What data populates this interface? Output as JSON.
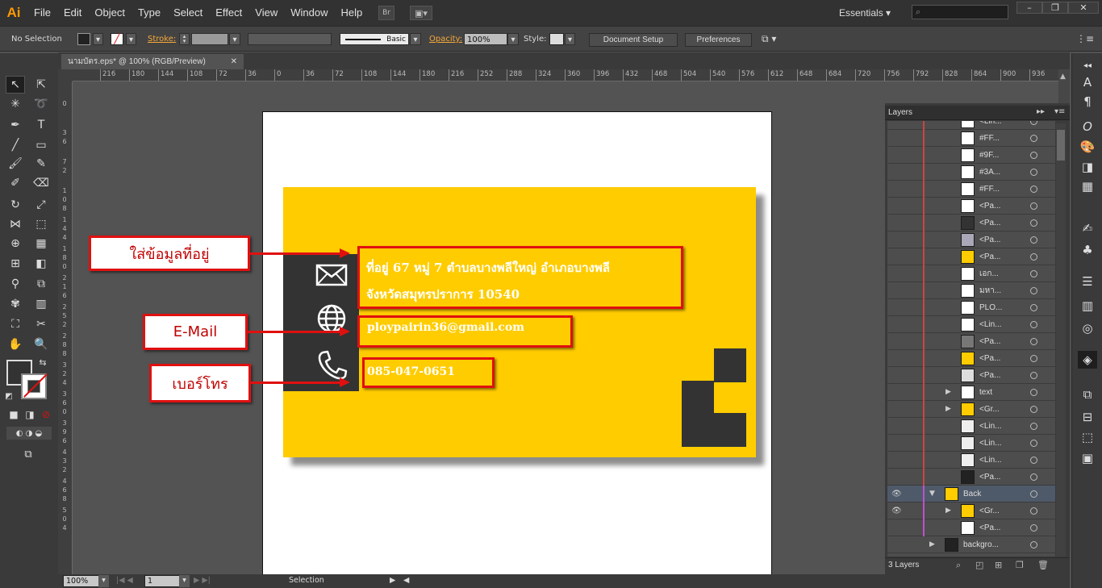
{
  "app": {
    "logo": "Ai"
  },
  "menu": [
    "File",
    "Edit",
    "Object",
    "Type",
    "Select",
    "Effect",
    "View",
    "Window",
    "Help"
  ],
  "bridge_label": "Br",
  "workspace": "Essentials",
  "control": {
    "selection": "No Selection",
    "stroke_label": "Stroke:",
    "stroke_style": "Basic",
    "opacity_label": "Opacity:",
    "opacity_value": "100%",
    "style_label": "Style:",
    "doc_setup": "Document Setup",
    "preferences": "Preferences"
  },
  "document": {
    "tab": "นามบัตร.eps* @ 100% (RGB/Preview)"
  },
  "ruler_h": [
    "216",
    "180",
    "144",
    "108",
    "72",
    "36",
    "0",
    "36",
    "72",
    "108",
    "144",
    "180",
    "216",
    "252",
    "288",
    "324",
    "360",
    "396",
    "432",
    "468",
    "504",
    "540",
    "576",
    "612",
    "648",
    "684",
    "720",
    "756",
    "792",
    "828",
    "864",
    "900",
    "936",
    "97"
  ],
  "ruler_v": [
    "0",
    "3 6",
    "7 2",
    "1 0 8",
    "1 4 4",
    "1 8 0",
    "2 1 6",
    "2 5 2",
    "2 8 8",
    "3 2 4",
    "3 6 0",
    "3 9 6",
    "4 3 2",
    "4 6 8",
    "5 0 4"
  ],
  "card": {
    "address_line1": "ที่อยู่ 67 หมู่ 7 ตำบลบางพลีใหญ่ อำเภอบางพลี",
    "address_line2": "จังหวัดสมุทรปราการ 10540",
    "email": "ploypairin36@gmail.com",
    "phone": "085-047-0651",
    "yellow": "#ffcc00",
    "dark": "#333333"
  },
  "callouts": {
    "address": "ใส่ข้อมูลที่อยู่",
    "email": "E-Mail",
    "phone": "เบอร์โทร",
    "red": "#e01010"
  },
  "layers_panel": {
    "title": "Layers",
    "rows": [
      {
        "name": "<Lin...",
        "thumb": "#ffffff"
      },
      {
        "name": "#FF...",
        "thumb": "#ffffff"
      },
      {
        "name": "#9F...",
        "thumb": "#ffffff"
      },
      {
        "name": "#3A...",
        "thumb": "#ffffff"
      },
      {
        "name": "#FF...",
        "thumb": "#ffffff"
      },
      {
        "name": "<Pa...",
        "thumb": "#ffffff"
      },
      {
        "name": "<Pa...",
        "thumb": "#333333"
      },
      {
        "name": "<Pa...",
        "thumb": "#a8a8b8"
      },
      {
        "name": "<Pa...",
        "thumb": "#ffcc00"
      },
      {
        "name": "เอก...",
        "thumb": "#ffffff"
      },
      {
        "name": "มหา...",
        "thumb": "#ffffff"
      },
      {
        "name": "PLO...",
        "thumb": "#ffffff"
      },
      {
        "name": "<Lin...",
        "thumb": "#ffffff"
      },
      {
        "name": "<Pa...",
        "thumb": "#777777"
      },
      {
        "name": "<Pa...",
        "thumb": "#ffcc00"
      },
      {
        "name": "<Pa...",
        "thumb": "#dddddd"
      },
      {
        "name": "text",
        "thumb": "#ffffff"
      },
      {
        "name": "<Gr...",
        "thumb": "#ffcc00"
      },
      {
        "name": "<Lin...",
        "thumb": "#eeeeee"
      },
      {
        "name": "<Lin...",
        "thumb": "#eeeeee"
      },
      {
        "name": "<Lin...",
        "thumb": "#eeeeee"
      },
      {
        "name": "<Pa...",
        "thumb": "#222222"
      },
      {
        "name": "Back",
        "thumb": "#ffcc00"
      },
      {
        "name": "<Gr...",
        "thumb": "#ffcc00"
      },
      {
        "name": "<Pa...",
        "thumb": "#ffffff"
      },
      {
        "name": "backgro...",
        "thumb": "#222222"
      }
    ],
    "count": "3 Layers"
  },
  "status": {
    "zoom": "100%",
    "artboard": "1",
    "tool": "Selection"
  }
}
